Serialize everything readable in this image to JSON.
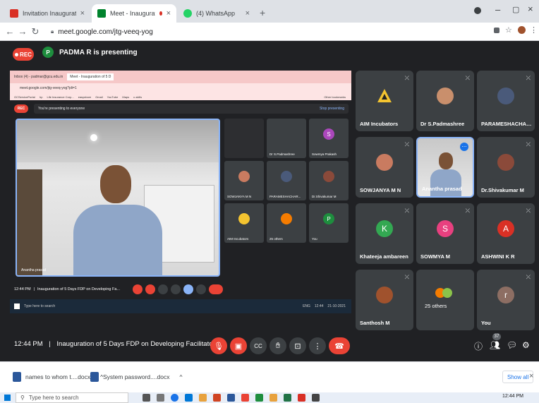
{
  "browser": {
    "tabs": [
      {
        "title": "Invitation Inauguration of 5 Day",
        "icon": "gmail-icon",
        "color": "#d93025"
      },
      {
        "title": "Meet - Inauguration of 5 Dc",
        "icon": "meet-icon",
        "color": "#00832d"
      },
      {
        "title": "(4) WhatsApp",
        "icon": "whatsapp-icon",
        "color": "#25d366"
      }
    ],
    "new_tab": "+",
    "url": "meet.google.com/jtg-veeq-yog"
  },
  "meet": {
    "rec_label": "REC",
    "presenter_initial": "P",
    "presenter_text": "PADMA R is presenting",
    "meeting_time": "12:44 PM",
    "meeting_separator": "|",
    "meeting_title": "Inauguration of 5 Days FDP on Developing Facilitato..."
  },
  "presented": {
    "tabs": [
      "Inbox (4) - padmar@gcu.edu.in",
      "Meet - Inauguration of 5 D"
    ],
    "url": "meet.google.com/jtg-veeq-yog?pli=1",
    "bookmarks": [
      "GCServicePortal",
      "Irp",
      "Life Insurance Corp...",
      "easyshare",
      "Gmail",
      "YouTube",
      "Maps",
      "c-skills",
      "Other bookmarks"
    ],
    "rec": "REC",
    "presenting_text": "You're presenting to everyone",
    "stop_text": "Stop presenting",
    "main_name": "Anantha prasad",
    "small_tiles": [
      "Dr S.Padmashree",
      "Sowmya Prakash",
      "SOWJANYA M N",
      "PARAMESHACHAR...",
      "Dr.Shivakumar M",
      "AIM Incubators",
      "25 others",
      "You"
    ],
    "ctrl_time": "12:44 PM",
    "ctrl_title": "Inauguration of 5 Days FDP on Developing Fa...",
    "taskbar_search": "Type here to search",
    "taskbar_lang": "ENG",
    "taskbar_time": "12:44",
    "taskbar_date": "21-10-2021"
  },
  "participants": [
    {
      "name": "AIM Incubators",
      "kind": "logo",
      "color": "#f4c430"
    },
    {
      "name": "Dr S.Padmashree",
      "kind": "photo",
      "color": "#c98f6c"
    },
    {
      "name": "PARAMESHACHARI ...",
      "kind": "photo",
      "color": "#4a5a7a"
    },
    {
      "name": "SOWJANYA M N",
      "kind": "photo",
      "color": "#c97b60"
    },
    {
      "name": "Anantha prasad",
      "kind": "video",
      "color": "#9aa5b5"
    },
    {
      "name": "Dr.Shivakumar M",
      "kind": "photo",
      "color": "#8b4a3a"
    },
    {
      "name": "Khateeja ambareen",
      "kind": "letter",
      "letter": "K",
      "color": "#33a852"
    },
    {
      "name": "SOWMYA M",
      "kind": "letter",
      "letter": "S",
      "color": "#e8407f"
    },
    {
      "name": "ASHWINI K R",
      "kind": "letter",
      "letter": "A",
      "color": "#d93025"
    },
    {
      "name": "Santhosh M",
      "kind": "photo",
      "color": "#a0522d"
    },
    {
      "name": "25 others",
      "kind": "group",
      "color": "#f57c00"
    },
    {
      "name": "You",
      "kind": "letter",
      "letter": "r",
      "color": "#8d6e63"
    }
  ],
  "controls": {
    "people_count": "37"
  },
  "downloads": [
    {
      "name": "names to whom t....docx"
    },
    {
      "name": "System password....docx"
    }
  ],
  "show_all": "Show all",
  "windows": {
    "search_placeholder": "Type here to search",
    "time": "12:44 PM"
  }
}
